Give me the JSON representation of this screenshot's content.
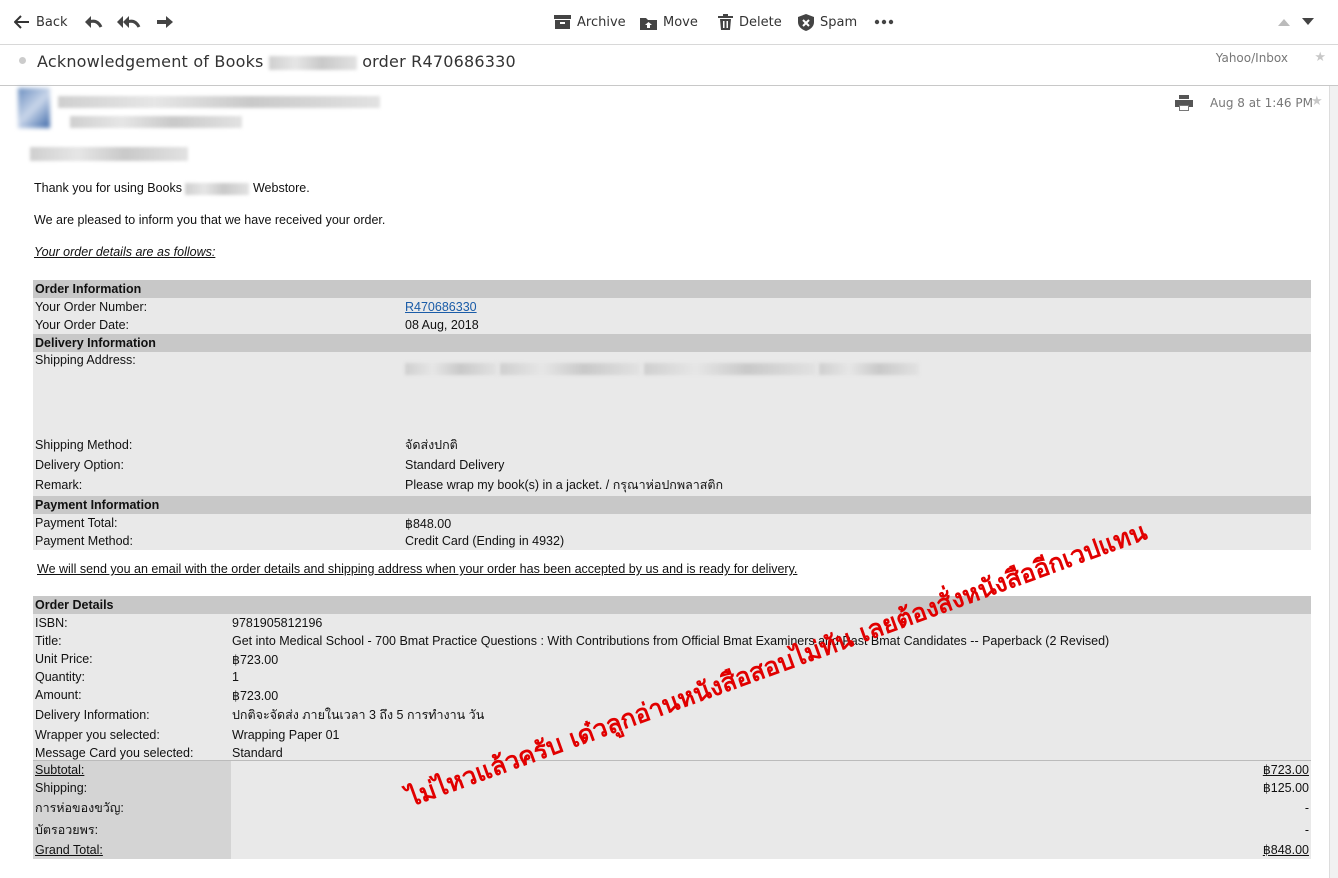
{
  "toolbar": {
    "back_label": "Back",
    "archive_label": "Archive",
    "move_label": "Move",
    "delete_label": "Delete",
    "spam_label": "Spam"
  },
  "subject": {
    "part1": "Acknowledgement of Books",
    "part2": "order R470686330",
    "folder": "Yahoo/Inbox"
  },
  "header": {
    "date": "Aug 8 at 1:46 PM"
  },
  "body": {
    "thanks_part1": "Thank you for using Books",
    "thanks_part2": "Webstore.",
    "pleased": "We are pleased to inform you that we have received your order.",
    "details_intro": "Your order details are as follows:",
    "will_send": "We will send you an email with the order details and shipping address when your order has been accepted by us and is ready for delivery."
  },
  "order_info": {
    "section_order": "Order Information",
    "order_number_label": "Your Order Number:",
    "order_number": "R470686330",
    "order_date_label": "Your Order Date:",
    "order_date": "08 Aug, 2018",
    "section_delivery": "Delivery Information",
    "shipping_address_label": "Shipping Address:",
    "shipping_method_label": "Shipping Method:",
    "shipping_method": "จัดส่งปกติ",
    "delivery_option_label": "Delivery Option:",
    "delivery_option": "Standard Delivery",
    "remark_label": "Remark:",
    "remark": "Please wrap my book(s) in a jacket. / กรุณาห่อปกพลาสติก",
    "section_payment": "Payment Information",
    "payment_total_label": "Payment Total:",
    "payment_total": "฿848.00",
    "payment_method_label": "Payment Method:",
    "payment_method": "Credit Card (Ending in 4932)"
  },
  "order_details": {
    "section": "Order Details",
    "isbn_label": "ISBN:",
    "isbn": "9781905812196",
    "title_label": "Title:",
    "title": "Get into Medical School - 700 Bmat Practice Questions : With Contributions from Official Bmat Examiners and Past Bmat Candidates -- Paperback (2 Revised)",
    "unit_price_label": "Unit Price:",
    "unit_price": "฿723.00",
    "quantity_label": "Quantity:",
    "quantity": "1",
    "amount_label": "Amount:",
    "amount": "฿723.00",
    "delivery_info_label": "Delivery Information:",
    "delivery_info": "ปกติจะจัดส่ง ภายในเวลา 3 ถึง 5 การทำงาน วัน",
    "wrapper_label": "Wrapper you selected:",
    "wrapper": "Wrapping Paper 01",
    "message_card_label": "Message Card you selected:",
    "message_card": "Standard"
  },
  "totals": {
    "subtotal_label": "Subtotal:",
    "subtotal": "฿723.00",
    "shipping_label": "Shipping:",
    "shipping": "฿125.00",
    "gift_wrap_label": "การห่อของขวัญ:",
    "gift_wrap": "-",
    "card_label": "บัตรอวยพร:",
    "card": "-",
    "grand_total_label": "Grand Total:",
    "grand_total": "฿848.00"
  },
  "annotation": "ไม่ไหวแล้วครับ เด๋วลูกอ่านหนังสือสอบไม่ทัน เลยต้องสั่งหนังสืออีกเวปแทน"
}
